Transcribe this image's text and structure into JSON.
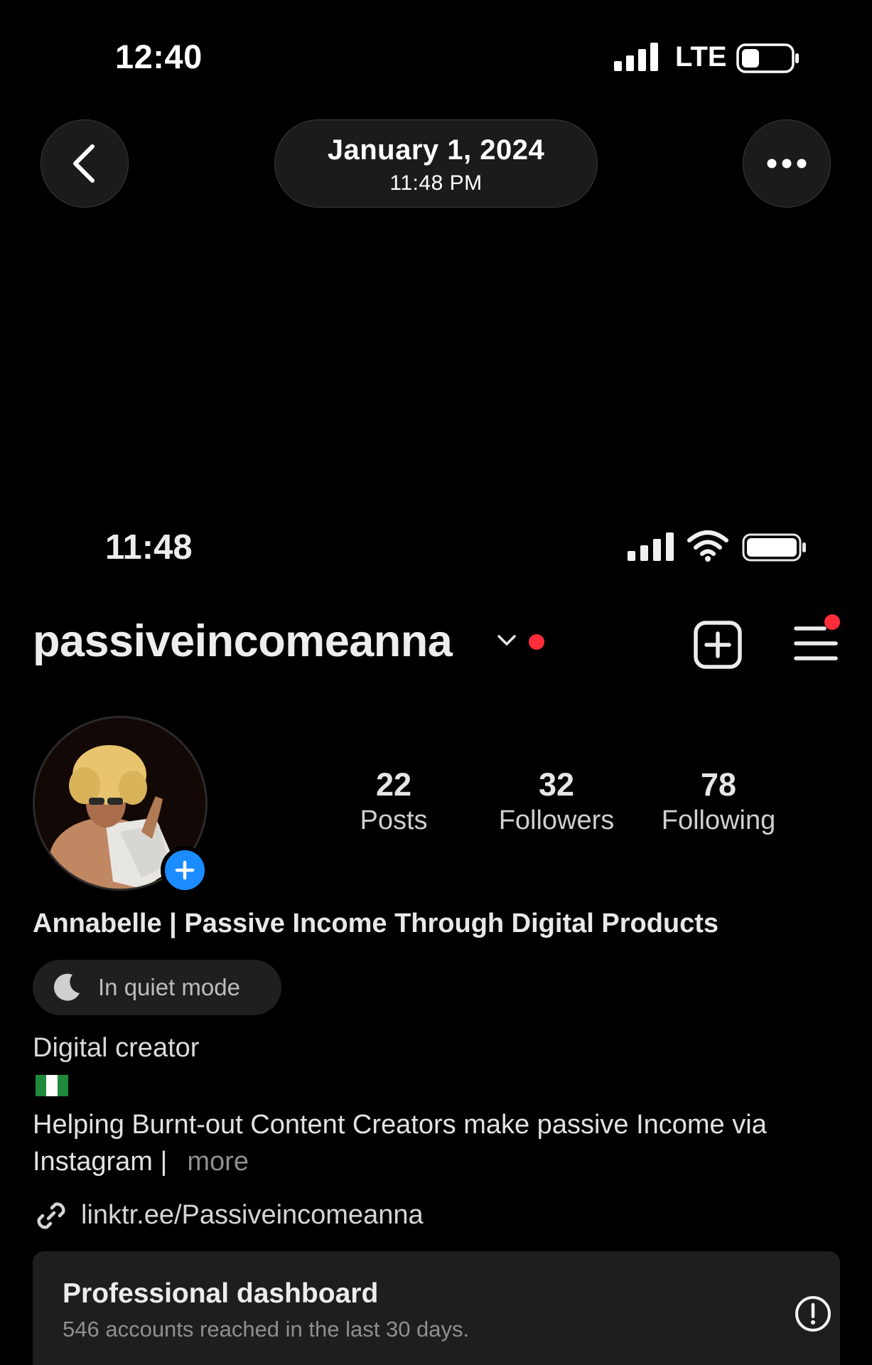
{
  "outer_status": {
    "time": "12:40",
    "network": "LTE"
  },
  "viewer": {
    "date": "January 1, 2024",
    "time": "11:48 PM",
    "back_icon": "chevron-left-icon",
    "more_icon": "ellipsis-icon"
  },
  "inner_status": {
    "time": "11:48"
  },
  "profile": {
    "username": "passiveincomeanna",
    "stats": [
      {
        "value": "22",
        "label": "Posts"
      },
      {
        "value": "32",
        "label": "Followers"
      },
      {
        "value": "78",
        "label": "Following"
      }
    ],
    "display_name": "Annabelle | Passive Income Through Digital Products",
    "quiet_mode": "In quiet mode",
    "category": "Digital creator",
    "bio": "Helping Burnt-out Content Creators make passive Income via Instagram |",
    "more": "more",
    "link": "linktr.ee/Passiveincomeanna"
  },
  "dashboard": {
    "title": "Professional dashboard",
    "subtitle": "546 accounts reached in the last 30 days."
  },
  "colors": {
    "background": "#000000",
    "notification_red": "#ff2d3a",
    "accent_blue": "#1a8cff",
    "flag_green": "#1f8a3c"
  }
}
